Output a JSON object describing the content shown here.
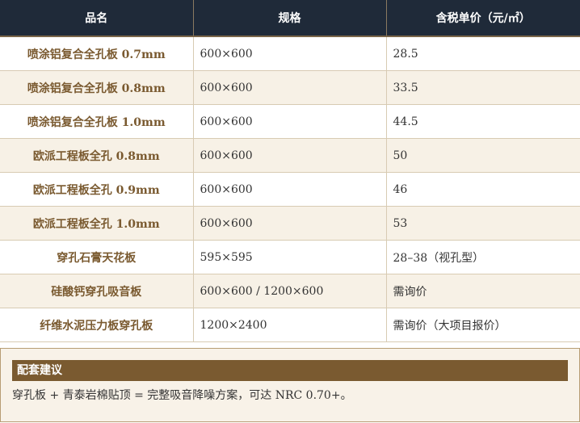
{
  "table": {
    "headers": [
      "品名",
      "规格",
      "含税单价（元/㎡）"
    ],
    "rows": [
      {
        "name": "喷涂铝复合全孔板 0.7mm",
        "spec": "600×600",
        "price": "28.5"
      },
      {
        "name": "喷涂铝复合全孔板 0.8mm",
        "spec": "600×600",
        "price": "33.5"
      },
      {
        "name": "喷涂铝复合全孔板 1.0mm",
        "spec": "600×600",
        "price": "44.5"
      },
      {
        "name": "欧派工程板全孔 0.8mm",
        "spec": "600×600",
        "price": "50"
      },
      {
        "name": "欧派工程板全孔 0.9mm",
        "spec": "600×600",
        "price": "46"
      },
      {
        "name": "欧派工程板全孔 1.0mm",
        "spec": "600×600",
        "price": "53"
      },
      {
        "name": "穿孔石膏天花板",
        "spec": "595×595",
        "price": "28–38（视孔型）"
      },
      {
        "name": "硅酸钙穿孔吸音板",
        "spec": "600×600 / 1200×600",
        "price": "需询价"
      },
      {
        "name": "纤维水泥压力板穿孔板",
        "spec": "1200×2400",
        "price": "需询价（大项目报价）"
      }
    ]
  },
  "tip": {
    "title": "配套建议",
    "text": "穿孔板 + 青泰岩棉贴顶 = 完整吸音降噪方案，可达 NRC 0.70+。"
  },
  "colors": {
    "header_bg": "#1f2a39",
    "accent_brown": "#7a5a30",
    "alt_row_bg": "#f7f1e6"
  }
}
